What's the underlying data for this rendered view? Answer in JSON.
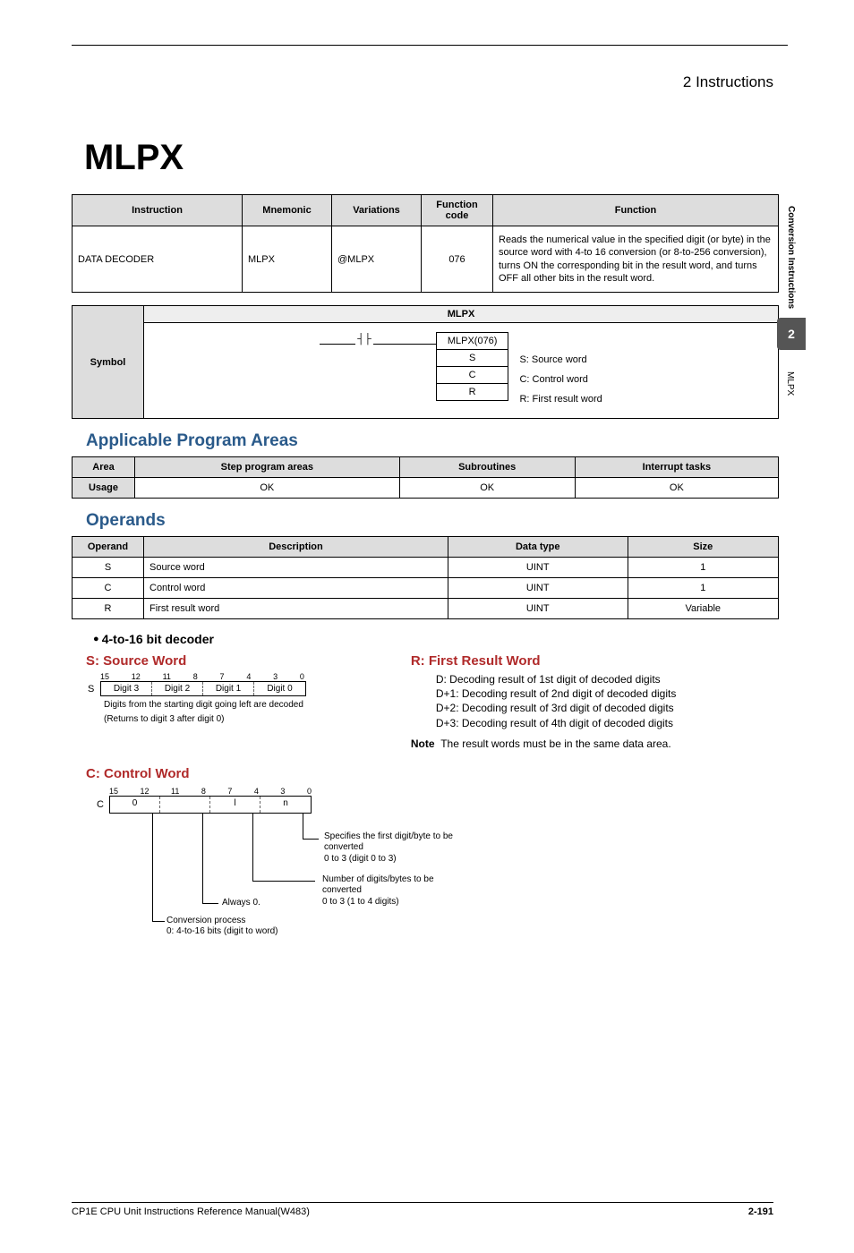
{
  "header": {
    "section": "2   Instructions"
  },
  "sidebar": {
    "group": "Conversion Instructions",
    "tab": "2",
    "instr": "MLPX"
  },
  "title": "MLPX",
  "table1": {
    "headers": [
      "Instruction",
      "Mnemonic",
      "Variations",
      "Function code",
      "Function"
    ],
    "row": {
      "instruction": "DATA DECODER",
      "mnemonic": "MLPX",
      "variations": "@MLPX",
      "code": "076",
      "function": "Reads the numerical value in the specified digit (or byte) in the source word with 4-to 16 conversion (or 8-to-256 conversion), turns ON the corresponding bit in the result word, and turns OFF all other bits in the result word."
    }
  },
  "symbol": {
    "label": "Symbol",
    "header": "MLPX",
    "box": [
      "MLPX(076)",
      "S",
      "C",
      "R"
    ],
    "ops": [
      "S: Source word",
      "C: Control word",
      "R: First result word"
    ]
  },
  "appAreas": {
    "title": "Applicable Program Areas",
    "headers": [
      "Area",
      "Step program areas",
      "Subroutines",
      "Interrupt tasks"
    ],
    "row": [
      "Usage",
      "OK",
      "OK",
      "OK"
    ]
  },
  "operands": {
    "title": "Operands",
    "headers": [
      "Operand",
      "Description",
      "Data type",
      "Size"
    ],
    "rows": [
      [
        "S",
        "Source word",
        "UINT",
        "1"
      ],
      [
        "C",
        "Control word",
        "UINT",
        "1"
      ],
      [
        "R",
        "First result word",
        "UINT",
        "Variable"
      ]
    ]
  },
  "decoder": {
    "bullet": "4-to-16 bit decoder",
    "source": {
      "title": "S: Source Word",
      "bits": [
        "15",
        "12",
        "11",
        "8",
        "7",
        "4",
        "3",
        "0"
      ],
      "lbl": "S",
      "digits": [
        "Digit 3",
        "Digit 2",
        "Digit 1",
        "Digit 0"
      ],
      "note1": "Digits from the starting digit going left are decoded",
      "note2": "(Returns to digit 3 after digit 0)"
    },
    "result": {
      "title": "R: First Result Word",
      "lines": [
        "D: Decoding result of 1st digit of decoded digits",
        "D+1: Decoding result of 2nd digit of decoded digits",
        "D+2: Decoding result of 3rd digit of decoded digits",
        "D+3: Decoding result of 4th digit of decoded digits"
      ],
      "note_label": "Note",
      "note": "The result words must be in the same data area."
    },
    "control": {
      "title": "C: Control Word",
      "bits": [
        "15",
        "12",
        "11",
        "8",
        "7",
        "4",
        "3",
        "0"
      ],
      "lbl": "C",
      "cells": [
        "0",
        "",
        "l",
        "n"
      ],
      "anno_n1": "Specifies the first digit/byte to be converted",
      "anno_n2": "0 to 3 (digit 0 to 3)",
      "anno_l1": "Number of digits/bytes to be converted",
      "anno_l2": "0 to 3 (1 to 4 digits)",
      "anno_mid": "Always 0.",
      "anno_top1": "Conversion process",
      "anno_top2": "0: 4-to-16 bits (digit to word)"
    }
  },
  "footer": {
    "manual": "CP1E CPU Unit Instructions Reference Manual(W483)",
    "page": "2-191"
  }
}
